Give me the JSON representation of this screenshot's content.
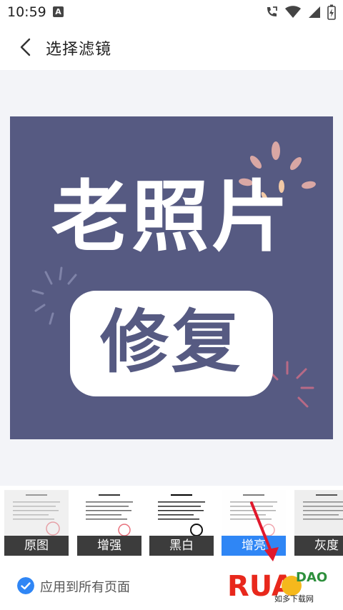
{
  "status": {
    "time": "10:59",
    "notification_badge": "A",
    "icons": [
      "call-forward-icon",
      "wifi-icon",
      "signal-icon",
      "battery-charging-icon"
    ]
  },
  "header": {
    "title": "选择滤镜",
    "back_icon": "chevron-left-icon"
  },
  "preview": {
    "headline": "老照片",
    "subline": "修复",
    "background_color": "#565a82"
  },
  "filters": [
    {
      "label": "原图",
      "selected": false
    },
    {
      "label": "增强",
      "selected": false
    },
    {
      "label": "黑白",
      "selected": false
    },
    {
      "label": "增亮",
      "selected": true
    },
    {
      "label": "灰度",
      "selected": false
    }
  ],
  "apply_all": {
    "label": "应用到所有页面",
    "checked": true
  },
  "watermark": {
    "brand": "RUANDAO",
    "subtitle": "如多下载网",
    "url": "www.ruadao.com"
  },
  "colors": {
    "accent": "#2f86f5",
    "filter_label_bg": "#3c3c3c"
  }
}
